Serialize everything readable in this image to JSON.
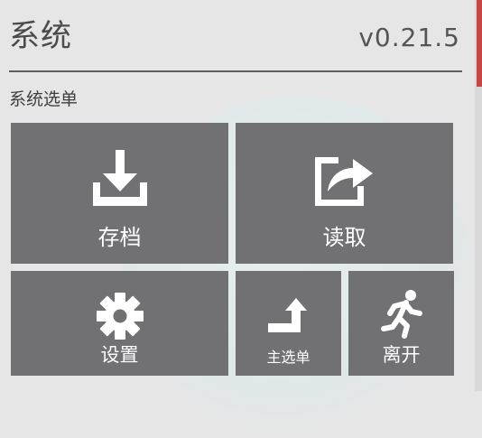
{
  "header": {
    "title": "系统",
    "version": "v0.21.5"
  },
  "section": {
    "label": "系统选单"
  },
  "tiles": {
    "save": {
      "label": "存档",
      "icon": "download-icon"
    },
    "load": {
      "label": "读取",
      "icon": "share-export-icon"
    },
    "settings": {
      "label": "设置",
      "icon": "gear-icon"
    },
    "main_menu": {
      "label": "主选单",
      "icon": "turn-up-arrow-icon"
    },
    "exit": {
      "label": "离开",
      "icon": "running-person-icon"
    }
  },
  "colors": {
    "background": "#e6e6e6",
    "tile": "#717173",
    "tile_text": "#ffffff",
    "scrollbar_thumb": "#c84545"
  }
}
